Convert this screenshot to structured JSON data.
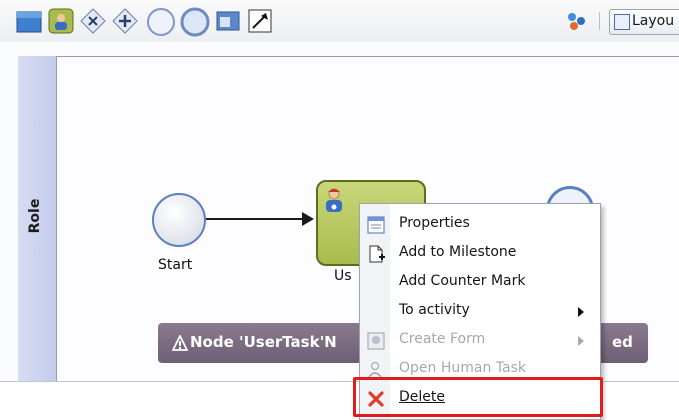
{
  "toolbar": {
    "tools": [
      {
        "name": "lane-tool",
        "color": "#3f7fd0"
      },
      {
        "name": "user-task-tool",
        "color": "#9fb44a"
      },
      {
        "name": "exclusive-gateway-tool",
        "color": "#c7d3ea"
      },
      {
        "name": "parallel-gateway-tool",
        "color": "#c7d3ea"
      },
      {
        "name": "start-event-tool",
        "color": "#c9d6ee"
      },
      {
        "name": "end-event-tool",
        "color": "#c9d6ee"
      },
      {
        "name": "annotation-tool",
        "color": "#5a88c8"
      },
      {
        "name": "connector-tool",
        "color": "#333333"
      }
    ],
    "layout_label": "Layou"
  },
  "lane": {
    "label": "Role"
  },
  "diagram": {
    "start_label": "Start",
    "task_label": "Us",
    "warning_text": "Node 'UserTask'N",
    "warning_tail": "ed"
  },
  "context_menu": {
    "items": [
      {
        "label": "Properties",
        "icon": "properties-icon",
        "enabled": true
      },
      {
        "label": "Add to Milestone",
        "icon": "milestone-icon",
        "enabled": true
      },
      {
        "label": "Add Counter Mark",
        "icon": "",
        "enabled": true
      },
      {
        "label": "To activity",
        "icon": "",
        "enabled": true,
        "submenu": true
      },
      {
        "label": "Create Form",
        "icon": "form-icon",
        "enabled": false,
        "submenu": true
      },
      {
        "label": "Open Human Task",
        "icon": "human-task-icon",
        "enabled": false
      },
      {
        "label": "Delete",
        "icon": "delete-icon",
        "enabled": true,
        "highlighted": true
      }
    ]
  },
  "colors": {
    "task_fill": "#b7c65f",
    "lane_header": "#ccd3ee",
    "warning_bg": "#7d6e82",
    "highlight": "#e01b1b",
    "delete_icon": "#e23b2e"
  }
}
